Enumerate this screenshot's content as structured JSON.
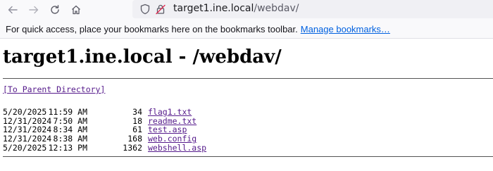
{
  "browser": {
    "url_host": "target1.ine.local",
    "url_path": "/webdav/",
    "icons": {
      "back": "back-arrow-icon",
      "forward": "forward-arrow-icon",
      "reload": "reload-icon",
      "home": "home-icon",
      "shield": "tracking-protection-shield-icon",
      "lock": "insecure-lock-icon"
    }
  },
  "bookmarks_bar": {
    "message": "For quick access, place your bookmarks here on the bookmarks toolbar.",
    "manage_link": "Manage bookmarks…"
  },
  "page": {
    "title": "target1.ine.local - /webdav/",
    "parent_link": "[To Parent Directory]",
    "files": [
      {
        "date": "5/20/2025",
        "time": "11:59 AM",
        "size": "34",
        "name": "flag1.txt"
      },
      {
        "date": "12/31/2024",
        "time": "7:50 AM",
        "size": "18",
        "name": "readme.txt"
      },
      {
        "date": "12/31/2024",
        "time": "8:34 AM",
        "size": "61",
        "name": "test.asp"
      },
      {
        "date": "12/31/2024",
        "time": "8:38 AM",
        "size": "168",
        "name": "web.config"
      },
      {
        "date": "5/20/2025",
        "time": "12:13 PM",
        "size": "1362",
        "name": "webshell.asp"
      }
    ]
  },
  "colors": {
    "link_visited": "#551a8b",
    "browser_link": "#0061e0",
    "toolbar_bg": "#f9f9fb",
    "urlbar_bg": "#f0f0f4"
  }
}
